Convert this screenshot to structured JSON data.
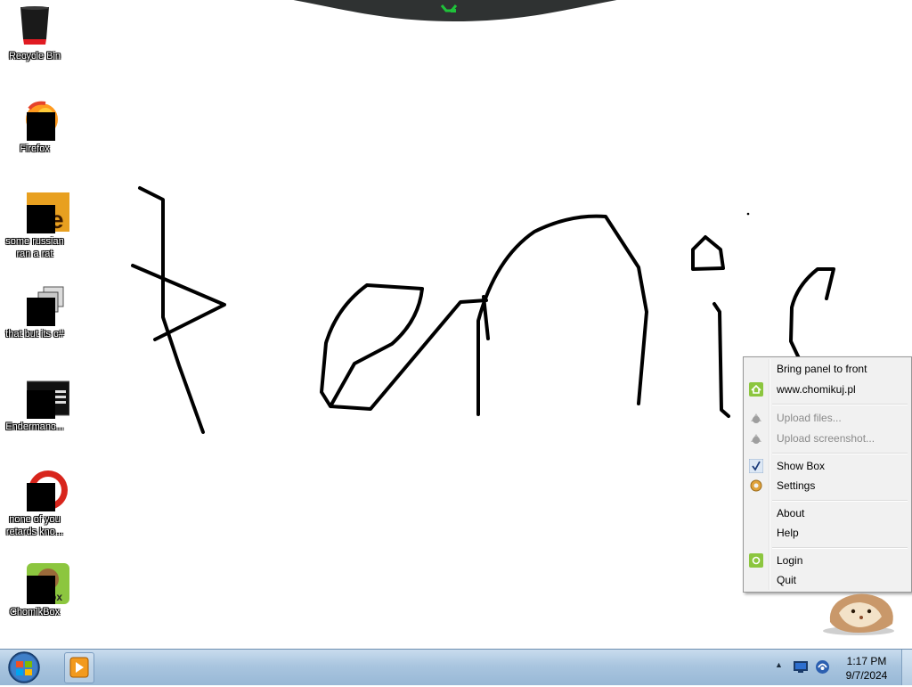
{
  "desktop": {
    "icons": [
      {
        "label": "Recycle Bin"
      },
      {
        "label": "Firefox"
      },
      {
        "label": "some russian\nran a rat"
      },
      {
        "label": "that but its c#"
      },
      {
        "label": "Endermanc..."
      },
      {
        "label": "none of you\nretards kno..."
      },
      {
        "label": "ChomikBox"
      }
    ]
  },
  "context_menu": {
    "items": [
      {
        "label": "Bring panel to front",
        "enabled": true
      },
      {
        "label": "www.chomikuj.pl",
        "enabled": true
      },
      {
        "label": "Upload files...",
        "enabled": false
      },
      {
        "label": "Upload screenshot...",
        "enabled": false
      },
      {
        "label": "Show Box",
        "enabled": true,
        "checked": true
      },
      {
        "label": "Settings",
        "enabled": true
      },
      {
        "label": "About",
        "enabled": true
      },
      {
        "label": "Help",
        "enabled": true
      },
      {
        "label": "Login",
        "enabled": true
      },
      {
        "label": "Quit",
        "enabled": true
      }
    ]
  },
  "taskbar": {
    "clock": {
      "time": "1:17 PM",
      "date": "9/7/2024"
    }
  },
  "colors": {
    "taskbar": "#a9c5df",
    "menu_bg": "#f1f1f1",
    "chomik_green": "#8cc63f"
  }
}
